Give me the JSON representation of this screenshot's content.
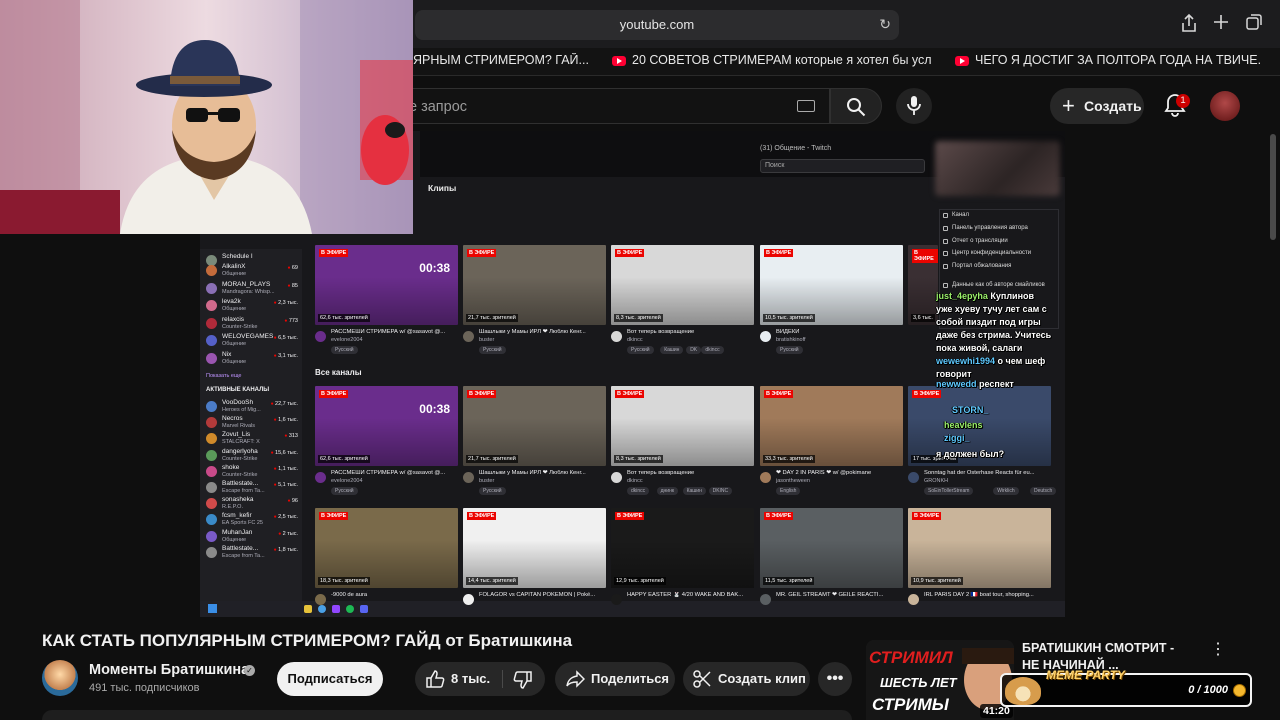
{
  "browser": {
    "url": "youtube.com",
    "tabs": [
      {
        "label": "ЯРНЫМ СТРИМЕРОМ? ГАЙ..."
      },
      {
        "label": "20 СОВЕТОВ СТРИМЕРАМ которые я хотел бы усл..."
      },
      {
        "label": "ЧЕГО Я ДОСТИГ ЗА ПОЛТОРА ГОДА НА ТВИЧЕ. 3..."
      }
    ]
  },
  "header": {
    "search_placeholder": "е запрос",
    "create_label": "Создать",
    "notifications_count": "1"
  },
  "twitch": {
    "window_title": "(31) Общение - Twitch",
    "search_placeholder": "Поиск",
    "clips_label": "Клипы",
    "all_channels_label": "Все каналы",
    "show_more": "Показать еще",
    "active_channels_label": "АКТИВНЫЕ КАНАЛЫ",
    "followed": [
      {
        "name": "Schedule I",
        "sub": "",
        "viewers": "",
        "color": "#7a8a7a"
      },
      {
        "name": "AlkalinX",
        "sub": "Общение",
        "viewers": "69",
        "color": "#c46b3b"
      },
      {
        "name": "MORAN_PLAYS",
        "sub": "Mandragora: Whisp...",
        "viewers": "85",
        "color": "#8a6fb5"
      },
      {
        "name": "leva2k",
        "sub": "Общение",
        "viewers": "2,3 тыс.",
        "color": "#d16a8c"
      },
      {
        "name": "relaxcis",
        "sub": "Counter-Strike",
        "viewers": "773",
        "color": "#b02a3a"
      },
      {
        "name": "WELOVEGAMES",
        "sub": "Общение",
        "viewers": "6,5 тыс.",
        "color": "#5560c8"
      },
      {
        "name": "Nix",
        "sub": "Общение",
        "viewers": "3,1 тыс.",
        "color": "#9a55b0"
      }
    ],
    "active": [
      {
        "name": "VooDooSh",
        "sub": "Heroes of Mig...",
        "viewers": "22,7 тыс.",
        "color": "#4b7cc8"
      },
      {
        "name": "Necros",
        "sub": "Marvel Rivals",
        "viewers": "1,6 тыс.",
        "color": "#b23a3a"
      },
      {
        "name": "Zovut_Lis",
        "sub": "STALCRAFT: X",
        "viewers": "313",
        "color": "#d08a2a"
      },
      {
        "name": "dangerlyoha",
        "sub": "Counter-Strike",
        "viewers": "15,6 тыс.",
        "color": "#5a9a5a"
      },
      {
        "name": "shoke",
        "sub": "Counter-Strike",
        "viewers": "1,1 тыс.",
        "color": "#c84a8a"
      },
      {
        "name": "Battlestate...",
        "sub": "Escape from Ta...",
        "viewers": "5,1 тыс.",
        "color": "#8a8a8a"
      },
      {
        "name": "sonasheka",
        "sub": "R.E.P.O.",
        "viewers": "96",
        "color": "#d04a4a"
      },
      {
        "name": "fcsm_kefir",
        "sub": "EA Sports FC 25",
        "viewers": "2,5 тыс.",
        "color": "#3a8ac8"
      },
      {
        "name": "MuhanJan",
        "sub": "Общение",
        "viewers": "2 тыс.",
        "color": "#7a5ac8"
      },
      {
        "name": "Battlestate...",
        "sub": "Escape from Ta...",
        "viewers": "1,8 тыс.",
        "color": "#8a8a8a"
      }
    ],
    "live_badge": "В ЭФИРЕ",
    "row1": [
      {
        "viewers": "62,6 тыс. зрителей",
        "title": "РАССМЕШИ СТРИМЕРА w/ @sasavot @...",
        "channel": "evelone2004",
        "tags": [
          "Русский"
        ],
        "timer": "00:38",
        "bg": "#6a2d8c"
      },
      {
        "viewers": "21,7 тыс. зрителей",
        "title": "Шашлыки у Мамы ИРЛ ❤ Люблю Кенг...",
        "channel": "buster",
        "tags": [
          "Русский"
        ],
        "timer": "",
        "bg": "#6b6459"
      },
      {
        "viewers": "8,3 тыс. зрителей",
        "title": "Вот теперь возвращение",
        "channel": "dkincc",
        "tags": [
          "Русский",
          "Кашин",
          "DK",
          "dkincc"
        ],
        "timer": "",
        "bg": "#d8d8d8"
      },
      {
        "viewers": "10,5 тыс. зрителей",
        "title": "ВИДЕКИ",
        "channel": "bratishkinoff",
        "tags": [
          "Русский"
        ],
        "timer": "",
        "bg": "#e8eef2"
      },
      {
        "viewers": "3,6 тыс.",
        "title": "",
        "channel": "",
        "tags": [],
        "timer": "",
        "bg": "#3a2f33"
      }
    ],
    "row2": [
      {
        "viewers": "62,6 тыс. зрителей",
        "title": "РАССМЕШИ СТРИМЕРА w/ @sasavot @...",
        "channel": "evelone2004",
        "tags": [
          "Русский"
        ],
        "timer": "00:38",
        "bg": "#6a2d8c"
      },
      {
        "viewers": "21,7 тыс. зрителей",
        "title": "Шашлыки у Мамы ИРЛ ❤ Люблю Кенг...",
        "channel": "buster",
        "tags": [
          "Русский"
        ],
        "timer": "",
        "bg": "#6b6459"
      },
      {
        "viewers": "8,3 тыс. зрителей",
        "title": "Вот теперь возвращение",
        "channel": "dkincc",
        "tags": [
          "dkincc",
          "днинк",
          "Кашин",
          "DKINC"
        ],
        "timer": "",
        "bg": "#d8d8d8"
      },
      {
        "viewers": "33,3 тыс. зрителей",
        "title": "❤ DAY 2 IN PARIS ❤ w/ @pokimane",
        "channel": "jasontheween",
        "tags": [
          "English"
        ],
        "timer": "",
        "bg": "#a07a5a"
      },
      {
        "viewers": "17 тыс. зрителей",
        "title": "Sonntag hat der Osterhase Reacts für eu...",
        "channel": "GRONKH",
        "tags": [
          "SoEinTollerStream",
          "Wirklich",
          "Deutsch"
        ],
        "timer": "",
        "bg": "#3a4a6a"
      }
    ],
    "row3": [
      {
        "viewers": "18,3 тыс. зрителей",
        "title": "-9000 de aura",
        "channel": "",
        "tags": [],
        "bg": "#7a6a4a"
      },
      {
        "viewers": "14,4 тыс. зрителей",
        "title": "FOLAGOR vs CAPITAN POKÉMON | Poké...",
        "channel": "",
        "tags": [],
        "bg": "#f0f0f0"
      },
      {
        "viewers": "12,9 тыс. зрителей",
        "title": "HAPPY EASTER 🐰 4/20 WAKE AND BAK...",
        "channel": "",
        "tags": [],
        "bg": "#1a1a1a"
      },
      {
        "viewers": "11,5 тыс. зрителей",
        "title": "MR. GEIL STREAMT ❤ GEILE REACTI...",
        "channel": "",
        "tags": [],
        "bg": "#5a5f62"
      },
      {
        "viewers": "10,9 тыс. зрителей",
        "title": "IRL PARIS DAY 2 🇫🇷 boat tour, shopping...",
        "channel": "",
        "tags": [],
        "bg": "#c9b49a"
      }
    ],
    "context_menu": [
      "Канал",
      "Панель управления автора",
      "Отчет о трансляции",
      "Центр конфиденциальности",
      "Портал обжалования",
      "Данные как об авторе смайликов"
    ],
    "chat": [
      {
        "name": "just_4eруhа",
        "text": " Куплинов",
        "color": "green"
      },
      {
        "name": "",
        "text": "уже хуеву тучу лет сам с",
        "color": ""
      },
      {
        "name": "",
        "text": "собой пиздит под игры",
        "color": ""
      },
      {
        "name": "",
        "text": "даже без стрима. Учитесь",
        "color": ""
      },
      {
        "name": "",
        "text": "пока живой, салаги",
        "color": ""
      },
      {
        "name": "wewewhi1994",
        "text": " о чем шеф",
        "color": "blue"
      },
      {
        "name": "",
        "text": "говорит",
        "color": ""
      },
      {
        "name": "newwedd",
        "text": " респект",
        "color": "blue"
      },
      {
        "name": "STORN_",
        "text": "",
        "color": "blue"
      },
      {
        "name": "heavlens",
        "text": "",
        "color": "green"
      },
      {
        "name": "ziggi_",
        "text": "",
        "color": "blue"
      },
      {
        "name": "",
        "text": "я должен был?",
        "color": ""
      }
    ]
  },
  "video": {
    "title": "КАК СТАТЬ ПОПУЛЯРНЫМ СТРИМЕРОМ? ГАЙД от Братишкина",
    "channel_name": "Моменты Братишкина",
    "subscribers": "491 тыс. подписчиков",
    "subscribe_label": "Подписаться",
    "likes": "8 тыс.",
    "share_label": "Поделиться",
    "clip_label": "Создать клип"
  },
  "recommended": {
    "title": "БРАТИШКИН СМОТРИТ - НЕ НАЧИНАЙ ...",
    "duration": "41:20",
    "thumb_line1": "СТРИМИЛ",
    "thumb_line2": "ШЕСТЬ ЛЕТ",
    "thumb_line3": "СТРИМЫ"
  },
  "overlay": {
    "meme_label": "MEME PARTY",
    "meme_count": "0 / 1000"
  },
  "colors": {
    "accent_red": "#ff0033",
    "twitch_live": "#eb0400",
    "twitch_purple": "#9147ff"
  }
}
